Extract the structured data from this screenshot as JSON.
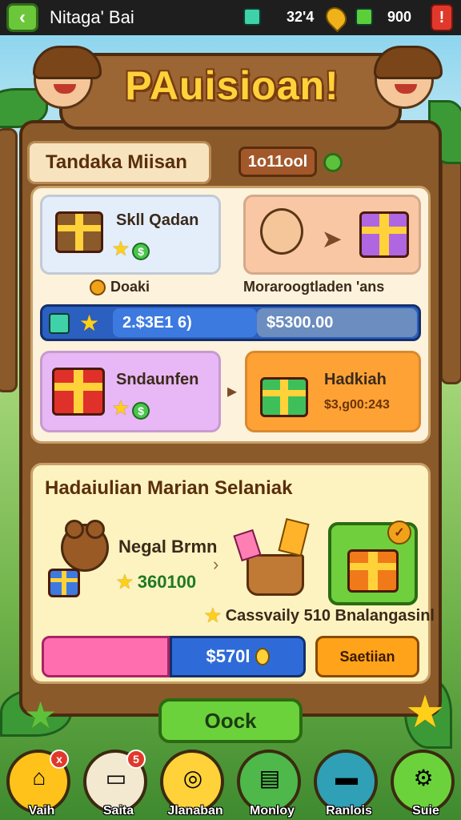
{
  "topbar": {
    "title": "Nitaga' Bai",
    "res1_value": "32'4",
    "res2_value": "900",
    "alert_label": "!"
  },
  "banner": {
    "title": "PAuisioan!"
  },
  "section": {
    "title": "Tandaka Miisan",
    "counter": "1o11ool"
  },
  "cards": {
    "c1": {
      "title": "Skll Qadan",
      "sub": "Doaki"
    },
    "c2": {
      "sub": "Moraroogtladen 'ans"
    },
    "c3": {
      "title": "Sndaunfen"
    },
    "c4": {
      "title": "Hadkiah",
      "value": "$3,g00:243"
    }
  },
  "stats": {
    "left": "2.$3E1 6)",
    "right": "$5300.00"
  },
  "bottom": {
    "title": "Hadaiulian Marian Selaniak",
    "char_name": "Negal Brmn",
    "char_value": "360100",
    "caption": "Cassvaily 510 Bnalangasinl",
    "price": "$570l",
    "action": "Saetiian"
  },
  "ok_button": "Oock",
  "nav": [
    {
      "label": "Vaih",
      "badge": "x"
    },
    {
      "label": "Saita",
      "badge": "5"
    },
    {
      "label": "Jlanaban",
      "badge": ""
    },
    {
      "label": "Monloy",
      "badge": ""
    },
    {
      "label": "Ranlois",
      "badge": ""
    },
    {
      "label": "Suie",
      "badge": ""
    }
  ],
  "colors": {
    "wood": "#8b5a2b",
    "gold_title": "#ffd23a",
    "ok_green": "#6cd23c",
    "accent_blue": "#2f6bd8"
  }
}
